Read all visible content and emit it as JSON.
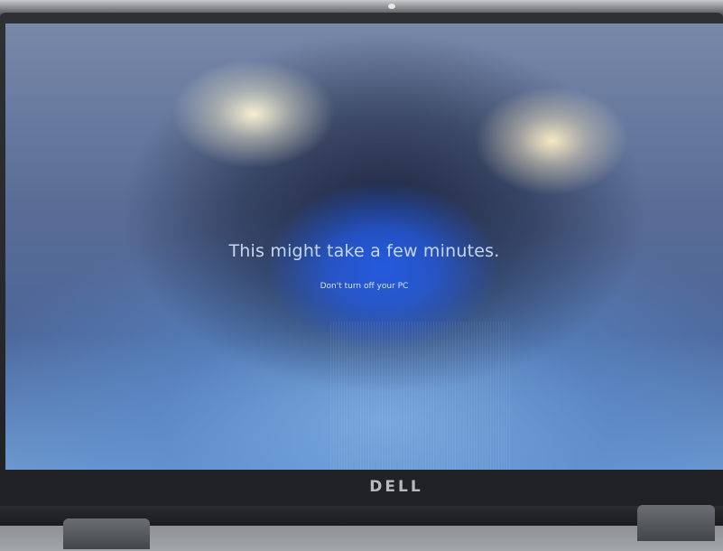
{
  "screen": {
    "headline": "This might take a few minutes.",
    "subline": "Don't turn off your PC"
  },
  "device": {
    "brand_logo": "DELL"
  },
  "colors": {
    "glow_blue": "#245ce6",
    "headline_text": "#c4d6f2",
    "bezel": "#2e3034"
  }
}
